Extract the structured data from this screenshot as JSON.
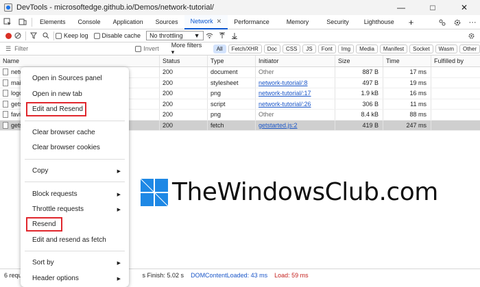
{
  "window": {
    "title": "DevTools - microsoftedge.github.io/Demos/network-tutorial/",
    "minimize": "—",
    "maximize": "□",
    "close": "✕"
  },
  "tabs": {
    "items": [
      "Elements",
      "Console",
      "Application",
      "Sources",
      "Network",
      "Performance",
      "Memory",
      "Security",
      "Lighthouse"
    ],
    "active": "Network",
    "close_glyph": "✕",
    "add_glyph": "+"
  },
  "toolbar": {
    "keep_log": "Keep log",
    "disable_cache": "Disable cache",
    "throttling": "No throttling"
  },
  "filterbar": {
    "placeholder": "Filter",
    "invert": "Invert",
    "more_filters": "More filters",
    "chips": [
      "All",
      "Fetch/XHR",
      "Doc",
      "CSS",
      "JS",
      "Font",
      "Img",
      "Media",
      "Manifest",
      "Socket",
      "Wasm",
      "Other"
    ],
    "active_chip": "All"
  },
  "grid": {
    "columns": [
      "Name",
      "Status",
      "Type",
      "Initiator",
      "Size",
      "Time",
      "Fulfilled by"
    ],
    "rows": [
      {
        "name": "netw",
        "status": "200",
        "type": "document",
        "initiator": "Other",
        "initiator_link": false,
        "size": "887 B",
        "time": "17 ms"
      },
      {
        "name": "mai",
        "status": "200",
        "type": "stylesheet",
        "initiator": "network-tutorial/:8",
        "initiator_link": true,
        "size": "497 B",
        "time": "19 ms"
      },
      {
        "name": "logo",
        "status": "200",
        "type": "png",
        "initiator": "network-tutorial/:17",
        "initiator_link": true,
        "size": "1.9 kB",
        "time": "16 ms"
      },
      {
        "name": "gets",
        "status": "200",
        "type": "script",
        "initiator": "network-tutorial/:26",
        "initiator_link": true,
        "size": "306 B",
        "time": "11 ms"
      },
      {
        "name": "favi",
        "status": "200",
        "type": "png",
        "initiator": "Other",
        "initiator_link": false,
        "size": "8.4 kB",
        "time": "88 ms"
      },
      {
        "name": "gets",
        "status": "200",
        "type": "fetch",
        "initiator": "getstarted.js:2",
        "initiator_link": true,
        "size": "419 B",
        "time": "247 ms",
        "selected": true
      }
    ]
  },
  "statusbar": {
    "requests": "6 requ",
    "finish": "s   Finish: 5.02 s",
    "dcl": "DOMContentLoaded: 43 ms",
    "load": "Load: 59 ms"
  },
  "context_menu": {
    "open_sources": "Open in Sources panel",
    "open_tab": "Open in new tab",
    "edit_resend": "Edit and Resend",
    "clear_cache": "Clear browser cache",
    "clear_cookies": "Clear browser cookies",
    "copy": "Copy",
    "block": "Block requests",
    "throttle": "Throttle requests",
    "resend": "Resend",
    "edit_resend_fetch": "Edit and resend as fetch",
    "sort_by": "Sort by",
    "header_options": "Header options",
    "submenu_glyph": "▶"
  },
  "watermark": {
    "text": "TheWindowsClub.com"
  },
  "colors": {
    "accent": "#0b57d0",
    "highlight_box": "#e0262c",
    "record": "#d93025",
    "link": "#1a56c8"
  }
}
